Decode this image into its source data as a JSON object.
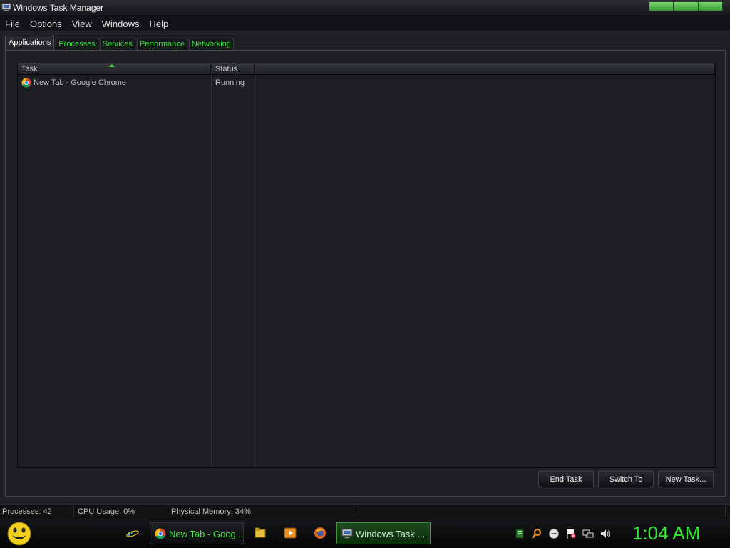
{
  "window": {
    "title": "Windows Task Manager"
  },
  "menu": [
    "File",
    "Options",
    "View",
    "Windows",
    "Help"
  ],
  "tabs": [
    {
      "label": "Applications",
      "active": true
    },
    {
      "label": "Processes",
      "active": false
    },
    {
      "label": "Services",
      "active": false
    },
    {
      "label": "Performance",
      "active": false
    },
    {
      "label": "Networking",
      "active": false
    }
  ],
  "table": {
    "columns": [
      "Task",
      "Status"
    ],
    "rows": [
      {
        "task": "New Tab - Google Chrome",
        "status": "Running",
        "icon": "chrome-icon"
      }
    ]
  },
  "buttons": {
    "end_task": "End Task",
    "switch_to": "Switch To",
    "new_task": "New Task..."
  },
  "status_bar": {
    "processes": "Processes: 42",
    "cpu": "CPU Usage: 0%",
    "memory": "Physical Memory: 34%"
  },
  "taskbar": {
    "chrome_task": "New Tab - Goog...",
    "taskmgr_task": "Windows Task ...",
    "clock": "1:04 AM"
  },
  "colors": {
    "accent_green": "#2ee52e",
    "background": "#1e2024",
    "tab_inactive_text": "#35e035"
  }
}
